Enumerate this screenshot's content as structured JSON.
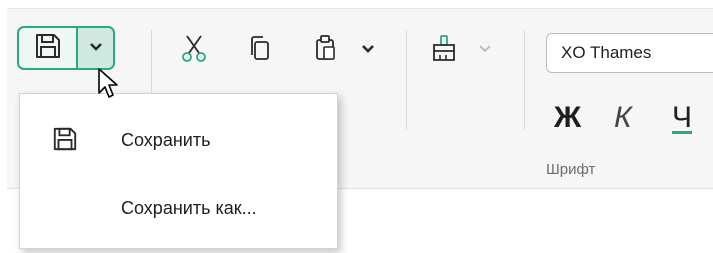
{
  "toolbar": {
    "save_icon": "floppy-disk-icon",
    "save_dropdown_icon": "chevron-down-icon",
    "cut_icon": "scissors-icon",
    "copy_icon": "copy-icon",
    "paste_icon": "clipboard-icon",
    "paste_dropdown_icon": "chevron-down-icon",
    "format_painter_icon": "paint-brush-icon",
    "format_painter_dropdown_icon": "chevron-down-icon"
  },
  "font_group": {
    "font_name": "XO Thames",
    "bold_label": "Ж",
    "italic_label": "К",
    "underline_label": "Ч",
    "group_label": "Шрифт"
  },
  "save_menu": {
    "items": [
      {
        "label": "Сохранить",
        "icon": "floppy-disk-icon"
      },
      {
        "label": "Сохранить как..."
      }
    ]
  },
  "colors": {
    "accent": "#27a888",
    "accent_fill": "#cfe9df",
    "text": "#1f1f1f",
    "muted": "#6d6d6d"
  }
}
